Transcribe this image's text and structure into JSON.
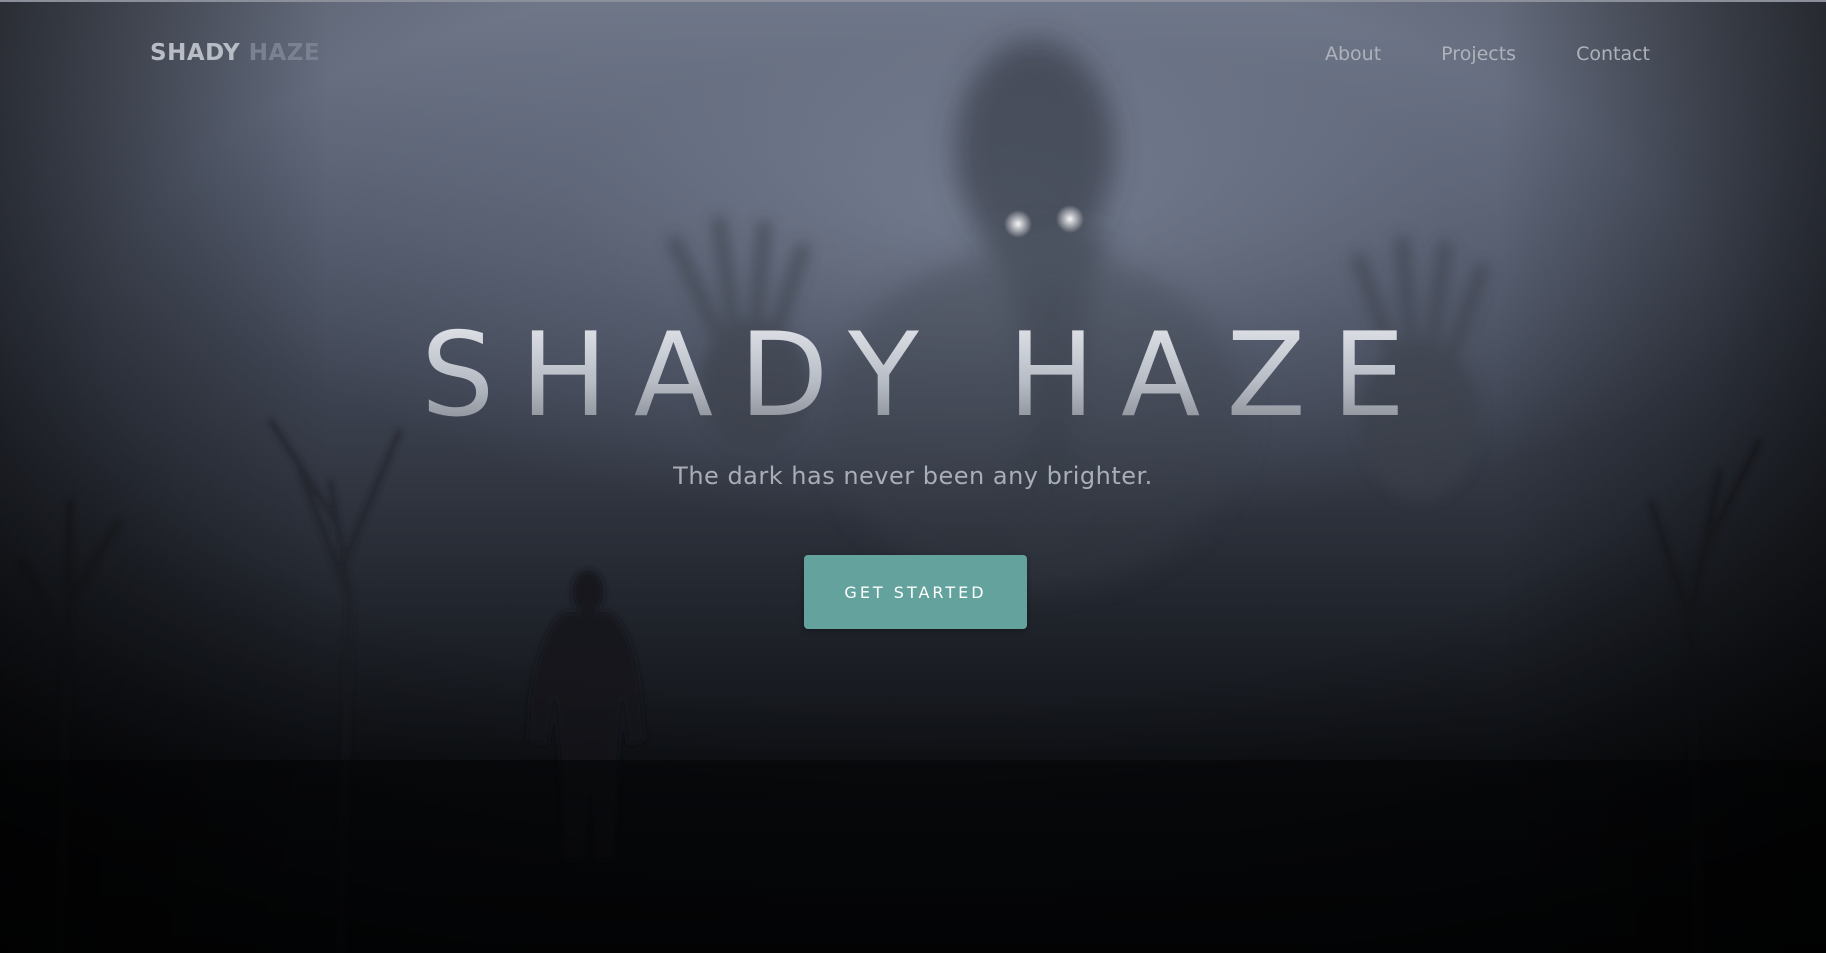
{
  "brand": {
    "part1": "SHADY",
    "part2": "HAZE"
  },
  "nav": {
    "items": [
      {
        "label": "About"
      },
      {
        "label": "Projects"
      },
      {
        "label": "Contact"
      }
    ]
  },
  "hero": {
    "title": "SHADY HAZE",
    "subtitle": "The dark has never been any brighter.",
    "cta_label": "GET STARTED"
  },
  "colors": {
    "accent": "#64a39d",
    "text_light": "#aeb2ba",
    "background_dark": "#07080b"
  },
  "icons": {
    "background": "foggy-forest-ghost-illustration"
  }
}
